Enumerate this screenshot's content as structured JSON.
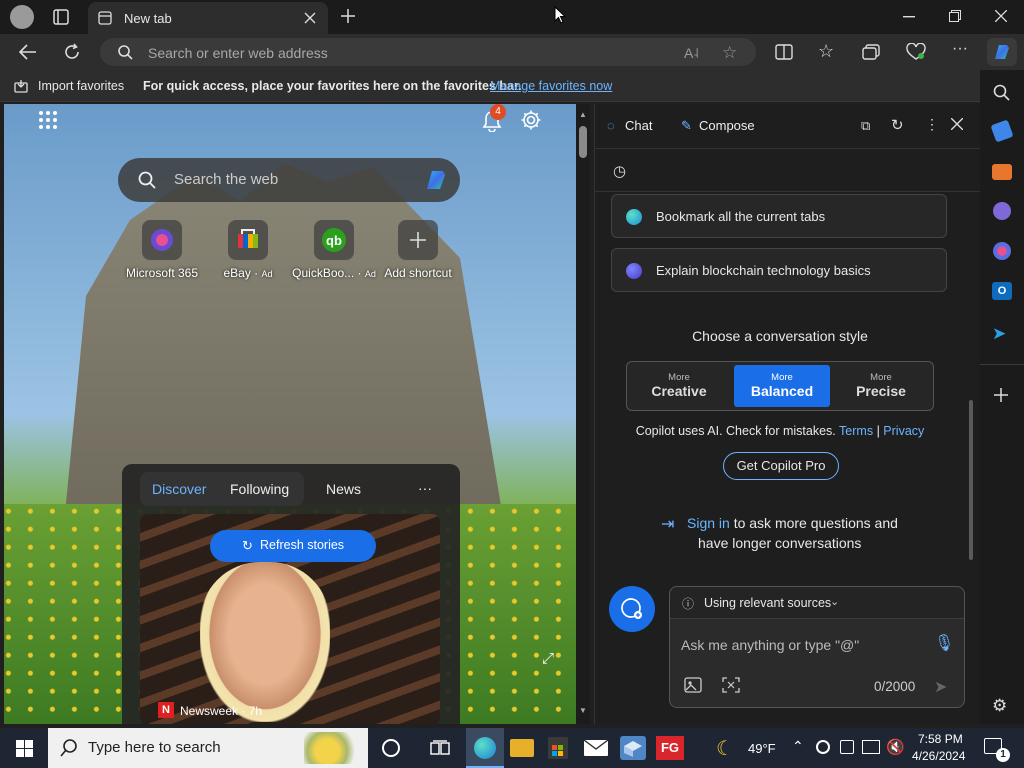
{
  "tab": {
    "title": "New tab"
  },
  "address": {
    "placeholder": "Search or enter web address"
  },
  "favorites": {
    "import_label": "Import favorites",
    "message": "For quick access, place your favorites here on the favorites bar.",
    "manage_link": "Manage manage favorites now",
    "manage_text": "Manage favorites now"
  },
  "ntp": {
    "notification_count": "4",
    "search_placeholder": "Search the web",
    "shortcuts": [
      {
        "label": "Microsoft 365",
        "ad": ""
      },
      {
        "label": "eBay",
        "ad": "Ad"
      },
      {
        "label": "QuickBoo...",
        "ad": "Ad"
      },
      {
        "label": "Add shortcut",
        "ad": ""
      }
    ],
    "feed_tabs": [
      "Discover",
      "Following",
      "News"
    ],
    "refresh_label": "Refresh stories",
    "story_source": "Newsweek · 7h"
  },
  "copilot": {
    "tabs": [
      "Chat",
      "Compose"
    ],
    "suggestions": [
      "Bookmark all the current tabs",
      "Explain blockchain technology basics"
    ],
    "style_title": "Choose a conversation style",
    "styles": [
      {
        "top": "More",
        "label": "Creative"
      },
      {
        "top": "More",
        "label": "Balanced"
      },
      {
        "top": "More",
        "label": "Precise"
      }
    ],
    "disclaimer": "Copilot uses AI. Check for mistakes.",
    "terms": "Terms",
    "sep": "|",
    "privacy": "Privacy",
    "pro_button": "Get Copilot Pro",
    "signin_link": "Sign in",
    "signin_rest": "to ask more questions and",
    "signin_rest2": "have longer conversations",
    "sources_label": "Using relevant sources",
    "input_placeholder": "Ask me anything or type \"@\"",
    "char_count": "0/2000"
  },
  "taskbar": {
    "search_placeholder": "Type here to search",
    "temperature": "49°F",
    "time": "7:58 PM",
    "date": "4/26/2024",
    "notif_count": "1"
  },
  "colors": {
    "accent": "#1a6ee8",
    "link": "#6cb4ff",
    "balanced": "#1a6ee8"
  }
}
